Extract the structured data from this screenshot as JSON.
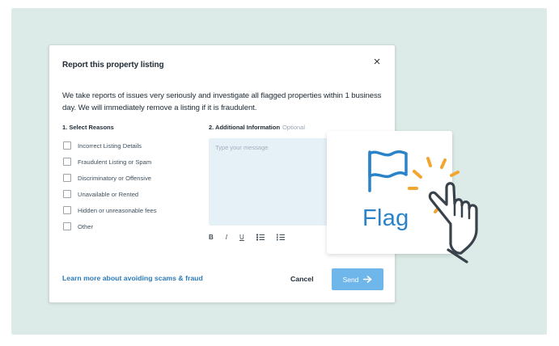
{
  "modal": {
    "title": "Report this property listing",
    "close_glyph": "×",
    "description": "We take reports of issues very seriously and investigate all flagged properties within 1 business day. We will immediately remove a listing if it is fraudulent.",
    "section_reasons": "1. Select Reasons",
    "section_info": "2. Additional Information",
    "section_info_optional": "Optional",
    "reasons": [
      "Incorrect Listing Details",
      "Fraudulent Listing or Spam",
      "Discriminatory or Offensive",
      "Unavailable or Rented",
      "Hidden or unreasonable fees",
      "Other"
    ],
    "message_placeholder": "Type your message",
    "toolbar": {
      "bold": "B",
      "italic": "I",
      "underline": "U"
    },
    "learn_link": "Learn more about avoiding scams & fraud",
    "cancel_label": "Cancel",
    "send_label": "Send"
  },
  "flag_card": {
    "label": "Flag"
  },
  "colors": {
    "backdrop": "#dcebe7",
    "brand_blue": "#2a83c9",
    "send_button": "#6fb6ea",
    "burst_orange": "#f2a531"
  }
}
